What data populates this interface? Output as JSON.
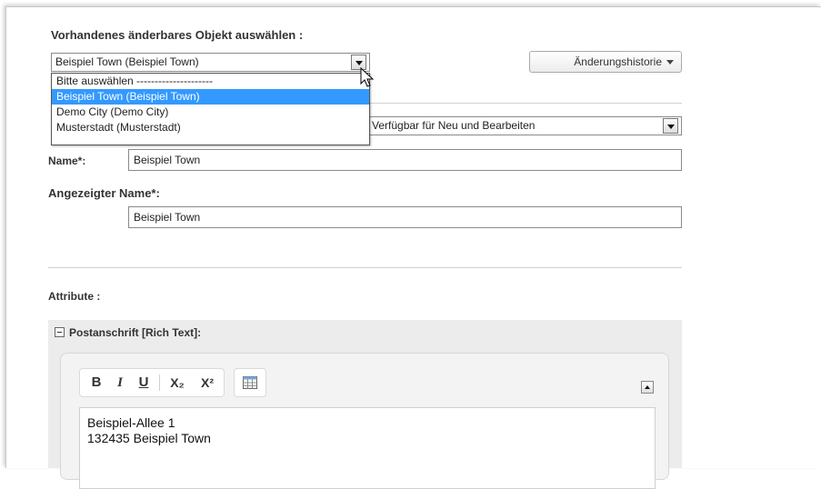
{
  "object_select": {
    "heading": "Vorhandenes änderbares Objekt auswählen :",
    "selected": "Beispiel Town (Beispiel Town)",
    "options": [
      "Bitte auswählen ---------------------",
      "Beispiel Town (Beispiel Town)",
      "Demo City (Demo City)",
      "Musterstadt (Musterstadt)"
    ]
  },
  "history_button": {
    "label": "Änderungshistorie"
  },
  "availability_select": {
    "selected": "Verfügbar für Neu und Bearbeiten"
  },
  "name_field": {
    "label": "Name*:",
    "value": "Beispiel Town"
  },
  "display_name_field": {
    "label": "Angezeigter Name*:",
    "value": "Beispiel Town"
  },
  "attributes": {
    "heading": "Attribute :"
  },
  "address_section": {
    "title": "Postanschrift [Rich Text]:",
    "toolbar": {
      "bold": "B",
      "italic": "I",
      "underline": "U",
      "subscript": "X₂",
      "superscript": "X²"
    },
    "lines": [
      "Beispiel-Allee 1",
      "132435 Beispiel Town"
    ]
  },
  "colors": {
    "selection": "#3399ff",
    "section_bg": "#ececec"
  }
}
